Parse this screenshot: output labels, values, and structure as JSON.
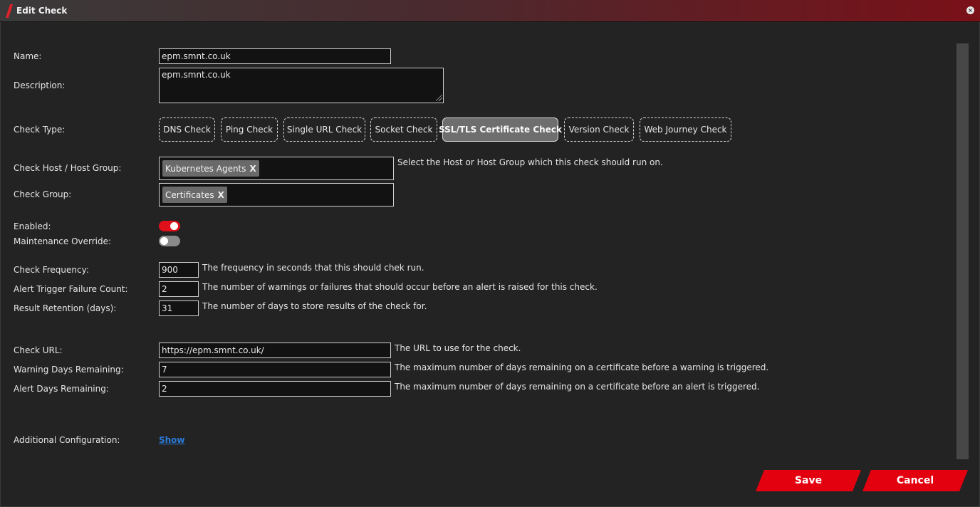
{
  "window": {
    "title": "Edit Check",
    "close_glyph": "×"
  },
  "form": {
    "name": {
      "label": "Name:",
      "value": "epm.smnt.co.uk"
    },
    "description": {
      "label": "Description:",
      "value": "epm.smnt.co.uk"
    },
    "check_type": {
      "label": "Check Type:",
      "options": [
        "DNS Check",
        "Ping Check",
        "Single URL Check",
        "Socket Check",
        "SSL/TLS Certificate Check",
        "Version Check",
        "Web Journey Check"
      ],
      "selected": "SSL/TLS Certificate Check"
    },
    "host_group": {
      "label": "Check Host / Host Group:",
      "tag": "Kubernetes Agents",
      "remove": "X",
      "help": "Select the Host or Host Group which this check should run on."
    },
    "check_group": {
      "label": "Check Group:",
      "tag": "Certificates",
      "remove": "X"
    },
    "enabled": {
      "label": "Enabled:",
      "on": true
    },
    "maintenance": {
      "label": "Maintenance Override:",
      "on": false
    },
    "frequency": {
      "label": "Check Frequency:",
      "value": "900",
      "help": "The frequency in seconds that this should chek run."
    },
    "failure_count": {
      "label": "Alert Trigger Failure Count:",
      "value": "2",
      "help": "The number of warnings or failures that should occur before an alert is raised for this check."
    },
    "retention": {
      "label": "Result Retention (days):",
      "value": "31",
      "help": "The number of days to store results of the check for."
    },
    "check_url": {
      "label": "Check URL:",
      "value": "https://epm.smnt.co.uk/",
      "help": "The URL to use for the check."
    },
    "warning_days": {
      "label": "Warning Days Remaining:",
      "value": "7",
      "help": "The maximum number of days remaining on a certificate before a warning is triggered."
    },
    "alert_days": {
      "label": "Alert Days Remaining:",
      "value": "2",
      "help": "The maximum number of days remaining on a certificate before an alert is triggered."
    },
    "additional": {
      "label": "Additional Configuration:",
      "link": "Show"
    }
  },
  "actions": {
    "save": "Save",
    "cancel": "Cancel"
  },
  "colors": {
    "accent": "#e3000f",
    "link": "#2a7ad8",
    "background": "#232323"
  }
}
